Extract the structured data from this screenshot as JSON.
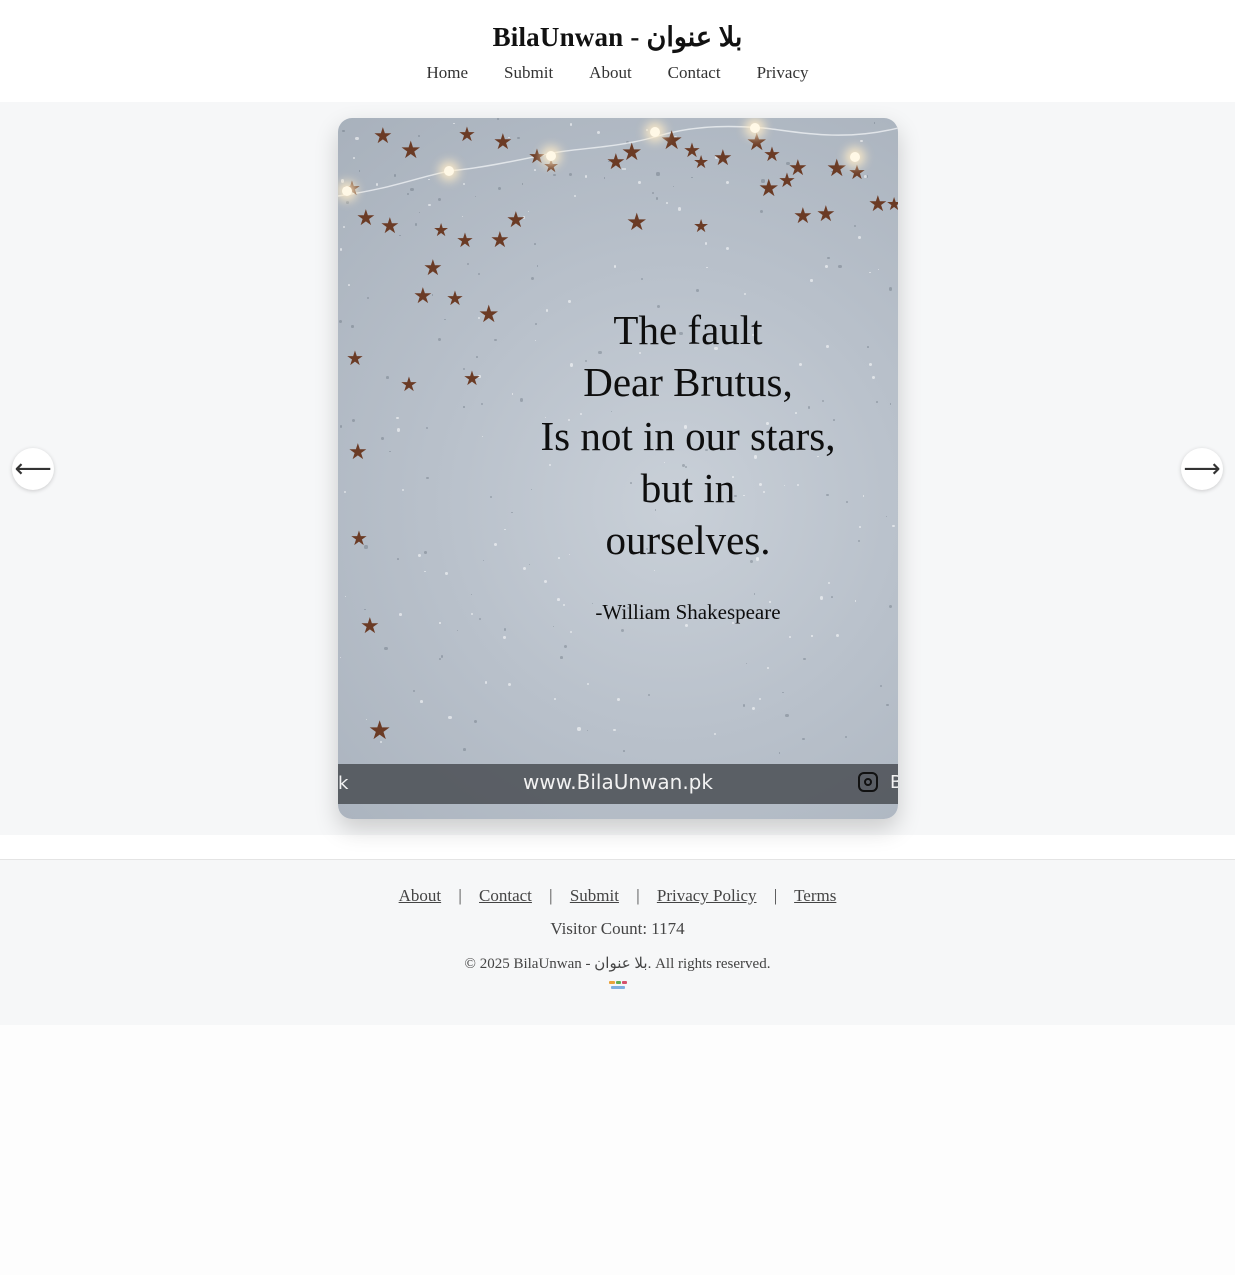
{
  "header": {
    "title": "BilaUnwan - بلا عنوان",
    "nav": [
      "Home",
      "Submit",
      "About",
      "Contact",
      "Privacy"
    ]
  },
  "gallery": {
    "prev_icon": "arrow-left-icon",
    "next_icon": "arrow-right-icon",
    "prev_glyph": "⟵",
    "next_glyph": "⟶",
    "card": {
      "quote_lines": [
        "The fault",
        "Dear Brutus,",
        "Is not in our stars,",
        "but in",
        "ourselves."
      ],
      "author": "-William Shakespeare",
      "website": "www.BilaUnwan.pk",
      "left_fragment": "k",
      "right_fragment": "B",
      "social_icon": "instagram-icon"
    }
  },
  "footer": {
    "links": [
      "About",
      "Contact",
      "Submit",
      "Privacy Policy",
      "Terms"
    ],
    "separator": "|",
    "visitor_count": "Visitor Count: 1174",
    "copyright": "© 2025 BilaUnwan - بلا عنوان. All rights reserved."
  },
  "colors": {
    "page_bg": "#f6f7f8",
    "card_bg": "#b9c1cb",
    "star": "#6b3b25",
    "footer_band": "#50545a"
  }
}
